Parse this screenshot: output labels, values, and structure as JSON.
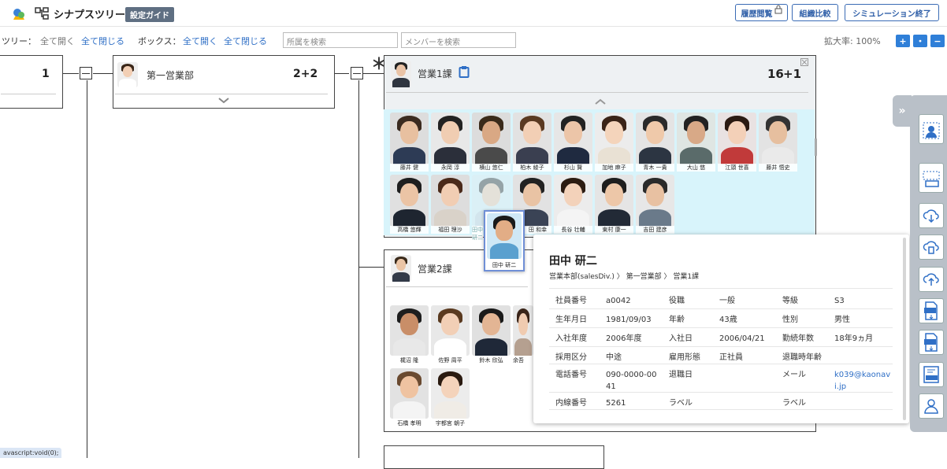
{
  "header": {
    "app_title": "シナプスツリー",
    "guide_badge": "設定ガイド",
    "btn_history": "履歴閲覧",
    "btn_compare": "組織比較",
    "btn_end_sim": "シミュレーション終了"
  },
  "toolbar": {
    "tree_label": "ツリー：",
    "open_all": "全て開く",
    "close_all": "全て閉じる",
    "box_label": "ボックス：",
    "box_open_all": "全て開く",
    "box_close_all": "全て閉じる",
    "dept_search_placeholder": "所属を検索",
    "member_search_placeholder": "メンバーを検索",
    "zoom": "拡大率: 100%",
    "zoom_buttons": [
      "+",
      "・",
      "−"
    ]
  },
  "org": {
    "root_count": "1",
    "dept1": {
      "name": "第一営業部",
      "count": "2+2"
    },
    "section1": {
      "name": "営業1課",
      "count_main": "16",
      "count_plus": "+1",
      "marker": "＊"
    },
    "section2": {
      "name": "営業2課"
    },
    "section1_members": [
      "藤井 健",
      "永岡 淳",
      "横山 悠仁",
      "柏木 綾子",
      "杉山 賢",
      "加地 麻子",
      "青木 一貴",
      "大山 悠",
      "江頭 世喜",
      "藤井 悟史",
      "高橋 悠輝",
      "福田 理沙",
      "田中 研二",
      "田 和幸",
      "長谷 壮輔",
      "東村 康一",
      "吉田 建彦"
    ],
    "section2_members": [
      "梶沼 隆",
      "佐野 周平",
      "鈴木 欣弘",
      "余吾",
      "石橋 孝明",
      "宇都宮 朝子"
    ],
    "drag_member": "田中 研二"
  },
  "profile": {
    "name": "田中 研二",
    "path": "営業本部(salesDiv.) 〉 第一営業部 〉 営業1課",
    "rows": [
      [
        "社員番号",
        "a0042",
        "役職",
        "一般",
        "等級",
        "S3"
      ],
      [
        "生年月日",
        "1981/09/03",
        "年齢",
        "43歳",
        "性別",
        "男性"
      ],
      [
        "入社年度",
        "2006年度",
        "入社日",
        "2006/04/21",
        "勤続年数",
        "18年9ヵ月"
      ],
      [
        "採用区分",
        "中途",
        "雇用形態",
        "正社員",
        "退職時年齢",
        ""
      ],
      [
        "電話番号",
        "090-0000-00\n41",
        "退職日",
        "",
        "メール",
        "k039@kaonav\ni.jp"
      ],
      [
        "内線番号",
        "5261",
        "ラベル",
        "",
        "ラベル",
        ""
      ]
    ]
  },
  "status_bar": "avascript:void(0);",
  "colors": {
    "accent": "#2f6fc6",
    "grid_bg": "#d8f4fb",
    "panel": "#b9c0c8"
  }
}
